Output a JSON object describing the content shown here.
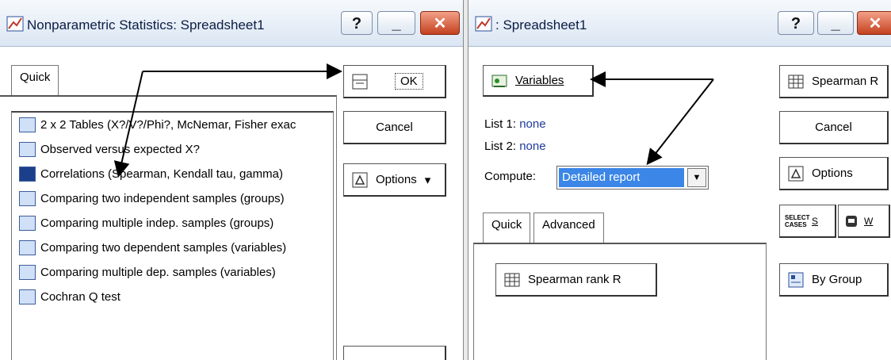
{
  "left_window": {
    "title": "Nonparametric Statistics: Spreadsheet1",
    "help_label": "?",
    "minimize_label": "_",
    "close_label": "✕",
    "tab_quick": "Quick",
    "ok_label": "OK",
    "cancel_label": "Cancel",
    "options_label": "Options",
    "options_arrow": "▾",
    "list_items": [
      "2 x 2 Tables (X?/V?/Phi?, McNemar, Fisher exac",
      "Observed versus expected X?",
      "Correlations (Spearman, Kendall tau, gamma)",
      "Comparing two independent samples (groups)",
      "Comparing multiple indep. samples (groups)",
      "Comparing two dependent samples (variables)",
      "Comparing multiple dep. samples (variables)",
      "Cochran Q test"
    ]
  },
  "right_window": {
    "title": ": Spreadsheet1",
    "help_label": "?",
    "minimize_label": "_",
    "close_label": "✕",
    "variables_label": "Variables",
    "list1_label": "List 1:",
    "list1_value": "none",
    "list2_label": "List 2:",
    "list2_value": "none",
    "compute_label": "Compute:",
    "compute_value": "Detailed report",
    "tab_quick": "Quick",
    "tab_advanced": "Advanced",
    "spearman_rank_label": "Spearman rank R",
    "spearman_r_label": "Spearman R",
    "cancel_label": "Cancel",
    "options_label": "Options",
    "select_cases_label": "SELECT CASES",
    "s_label": "S",
    "w_label": "W",
    "by_group_label": "By Group"
  }
}
